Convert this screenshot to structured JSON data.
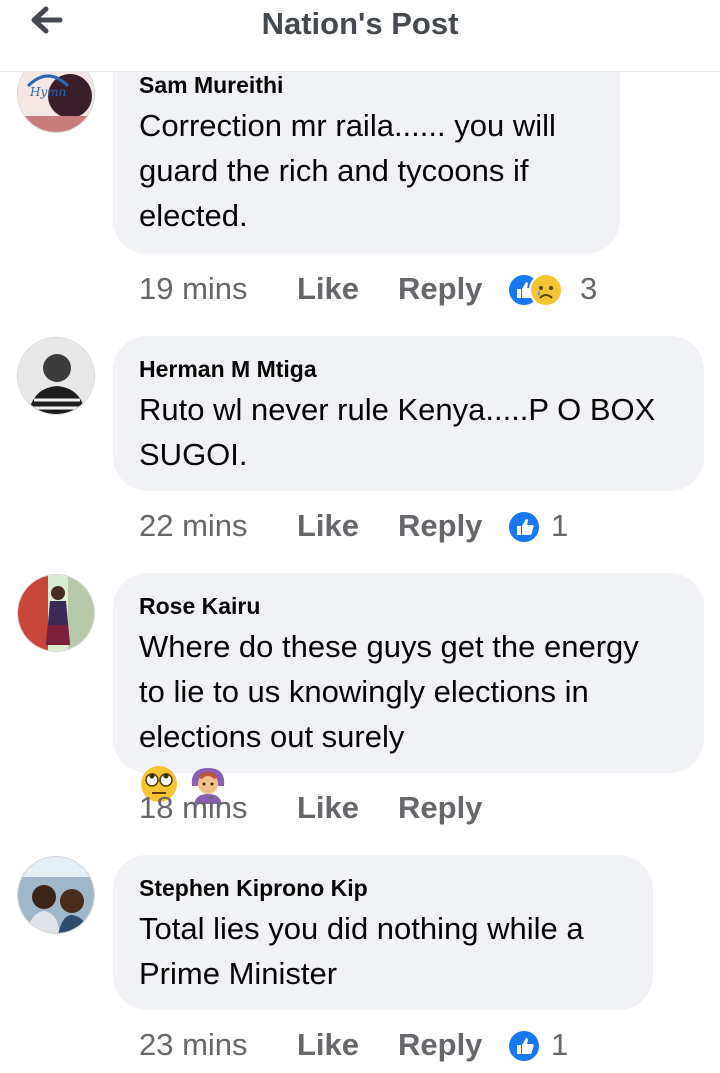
{
  "header": {
    "title": "Nation's Post",
    "back_icon": "arrow-left-icon"
  },
  "colors": {
    "bubble": "#f0f2f5",
    "meta_text": "#65676b",
    "like_blue": "#1877f2",
    "title": "#444950"
  },
  "comments": [
    {
      "author": "Sam Mureithi",
      "lines": [
        "Correction mr raila...... you will",
        "guard the rich and tycoons if",
        "elected."
      ],
      "time": "19 mins",
      "like_label": "Like",
      "reply_label": "Reply",
      "reactions": [
        "like-reaction-icon",
        "sad-reaction-icon"
      ],
      "reaction_count": "3"
    },
    {
      "author": "Herman M Mtiga",
      "lines": [
        "Ruto wl never rule Kenya.....P O BOX",
        "SUGOI."
      ],
      "time": "22 mins",
      "like_label": "Like",
      "reply_label": "Reply",
      "reactions": [
        "like-reaction-icon"
      ],
      "reaction_count": "1"
    },
    {
      "author": "Rose Kairu",
      "lines": [
        "Where do these guys get the energy",
        "to lie to us knowingly elections in",
        "elections out surely"
      ],
      "emojis": [
        "eye-roll-emoji",
        "facepalm-emoji"
      ],
      "time": "18 mins",
      "like_label": "Like",
      "reply_label": "Reply"
    },
    {
      "author": "Stephen Kiprono Kip",
      "lines": [
        "Total lies you did nothing while a",
        "Prime Minister"
      ],
      "time": "23 mins",
      "like_label": "Like",
      "reply_label": "Reply",
      "reactions": [
        "like-reaction-icon"
      ],
      "reaction_count": "1"
    }
  ]
}
